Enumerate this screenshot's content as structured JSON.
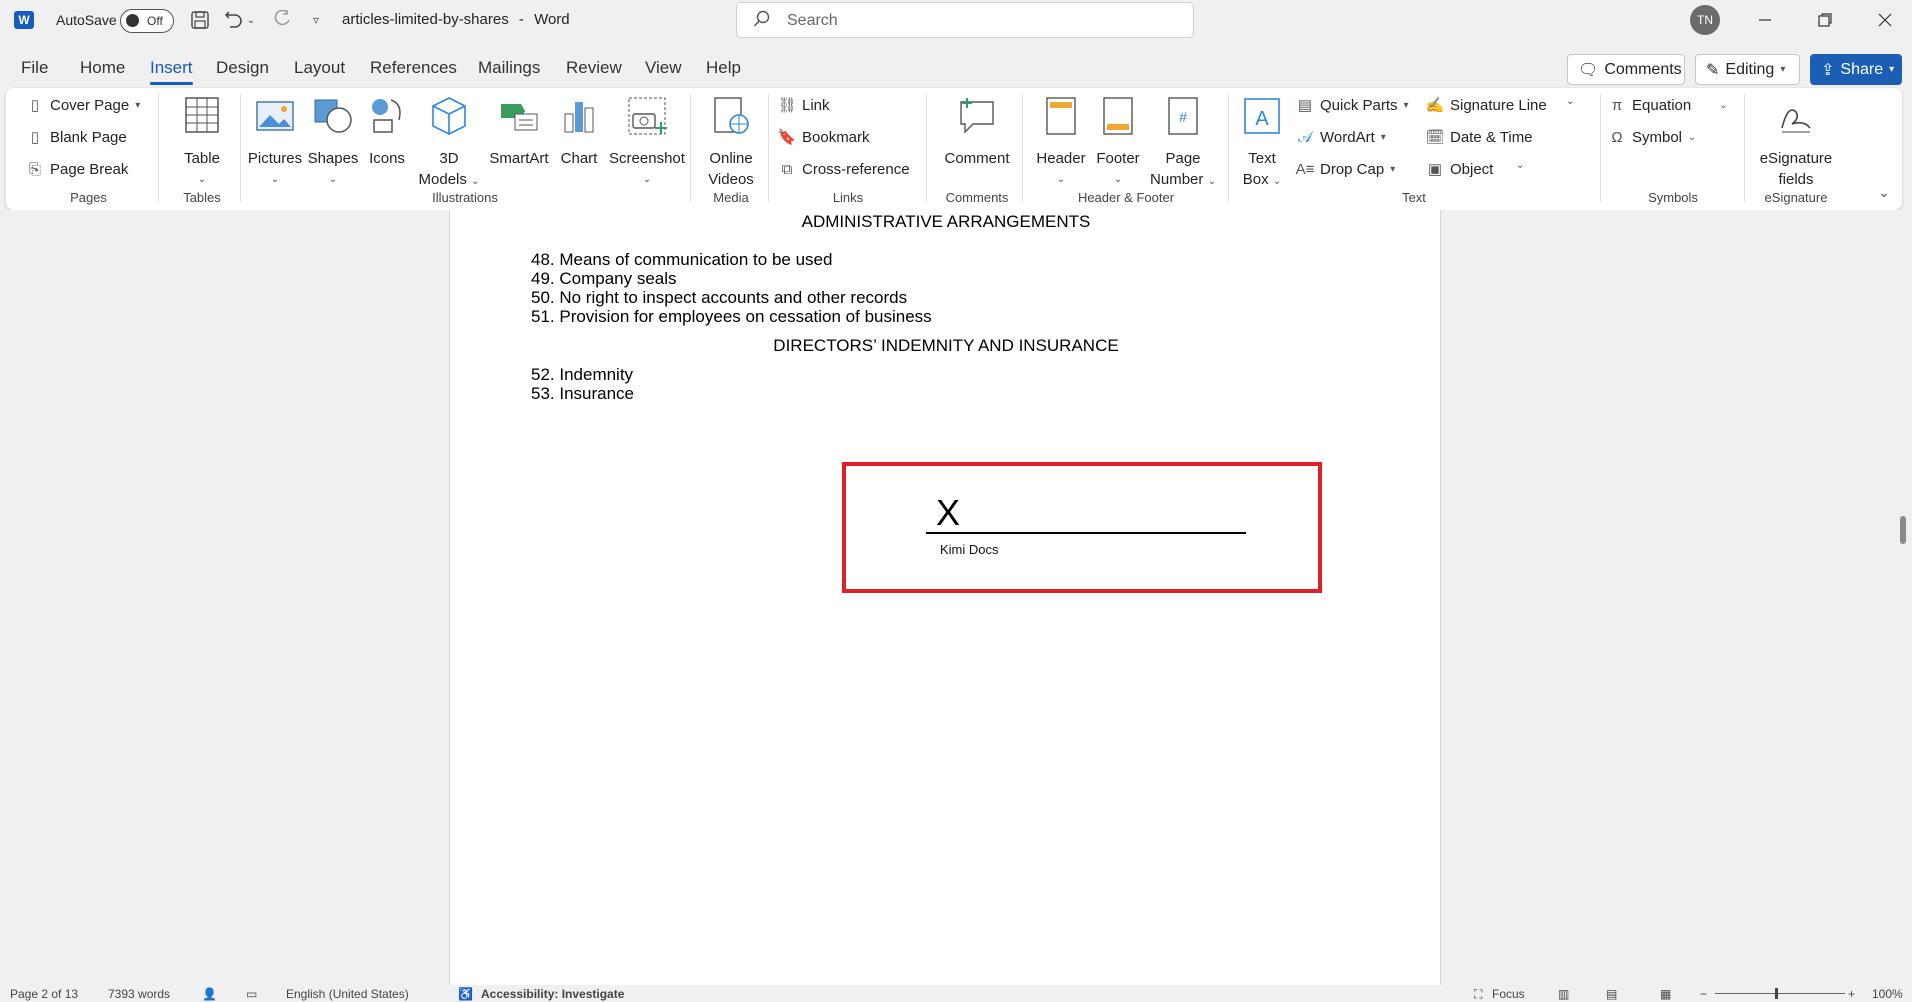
{
  "titlebar": {
    "app_letter": "W",
    "autosave_label": "AutoSave",
    "autosave_state": "Off",
    "document_name": "articles-limited-by-shares",
    "app_name": "Word",
    "separator": "-",
    "search_placeholder": "Search",
    "user_initials": "TN"
  },
  "menu": {
    "tabs": [
      "File",
      "Home",
      "Insert",
      "Design",
      "Layout",
      "References",
      "Mailings",
      "Review",
      "View",
      "Help"
    ],
    "active_tab": "Insert",
    "comments_label": "Comments",
    "editing_label": "Editing",
    "share_label": "Share"
  },
  "ribbon": {
    "pages": {
      "cover_page": "Cover Page",
      "blank_page": "Blank Page",
      "page_break": "Page Break",
      "group": "Pages"
    },
    "tables": {
      "table": "Table",
      "group": "Tables"
    },
    "illustrations": {
      "pictures": "Pictures",
      "shapes": "Shapes",
      "icons": "Icons",
      "models_line1": "3D",
      "models_line2": "Models",
      "smartart": "SmartArt",
      "chart": "Chart",
      "screenshot": "Screenshot",
      "group": "Illustrations"
    },
    "media": {
      "line1": "Online",
      "line2": "Videos",
      "group": "Media"
    },
    "links": {
      "link": "Link",
      "bookmark": "Bookmark",
      "cross_reference": "Cross-reference",
      "group": "Links"
    },
    "comments": {
      "comment": "Comment",
      "group": "Comments"
    },
    "header_footer": {
      "header": "Header",
      "footer": "Footer",
      "page_number_line1": "Page",
      "page_number_line2": "Number",
      "group": "Header & Footer"
    },
    "text": {
      "textbox_line1": "Text",
      "textbox_line2": "Box",
      "quick_parts": "Quick Parts",
      "wordart": "WordArt",
      "drop_cap": "Drop Cap",
      "signature_line": "Signature Line",
      "date_time": "Date & Time",
      "object": "Object",
      "group": "Text"
    },
    "symbols": {
      "equation": "Equation",
      "symbol": "Symbol",
      "group": "Symbols"
    },
    "esignature": {
      "line1": "eSignature",
      "line2": "fields",
      "group": "eSignature"
    }
  },
  "document": {
    "heading1": "ADMINISTRATIVE ARRANGEMENTS",
    "items1": [
      "48. Means of communication to be used",
      "49. Company seals",
      "50. No right to inspect accounts and other records",
      "51. Provision for employees on cessation of business"
    ],
    "heading2": "DIRECTORS’ INDEMNITY AND INSURANCE",
    "items2": [
      "52. Indemnity",
      "53. Insurance"
    ],
    "signature": {
      "mark": "X",
      "signer": "Kimi Docs"
    }
  },
  "statusbar": {
    "page": "Page 2 of 13",
    "words": "7393 words",
    "language": "English (United States)",
    "accessibility": "Accessibility: Investigate",
    "focus": "Focus",
    "zoom": "100%"
  },
  "colors": {
    "accent": "#185abd",
    "highlight_border": "#e01f26"
  }
}
